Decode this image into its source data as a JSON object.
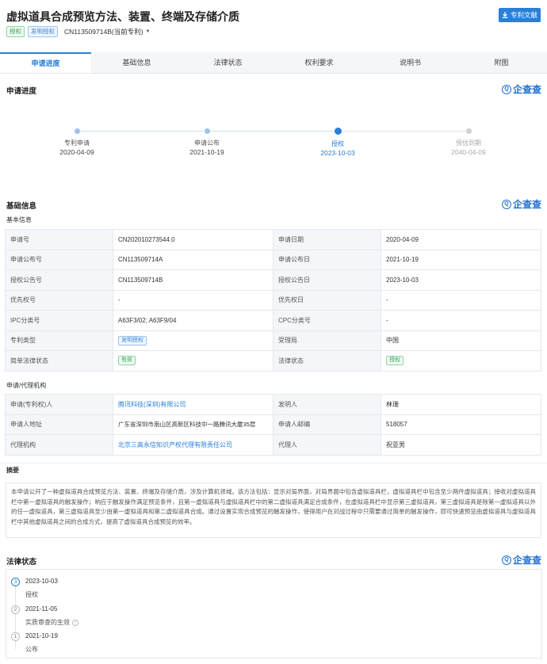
{
  "header": {
    "title": "虚拟道具合成预览方法、装置、终端及存储介质",
    "download_label": "专利文献",
    "tags": [
      "授权",
      "发明授权"
    ],
    "publication_selector": "CN113509714B(当前专利)"
  },
  "tabs": [
    {
      "label": "申请进度",
      "active": true
    },
    {
      "label": "基础信息"
    },
    {
      "label": "法律状态"
    },
    {
      "label": "权利要求"
    },
    {
      "label": "说明书"
    },
    {
      "label": "附图"
    }
  ],
  "brand": "企查查",
  "progress": {
    "title": "申请进度",
    "steps": [
      {
        "label": "专利申请",
        "date": "2020-04-09",
        "state": "done"
      },
      {
        "label": "申请公布",
        "date": "2021-10-19",
        "state": "done"
      },
      {
        "label": "授权",
        "date": "2023-10-03",
        "state": "current"
      },
      {
        "label": "预估到期",
        "date": "2040-04-09",
        "state": "future"
      }
    ]
  },
  "basic": {
    "title": "基础信息",
    "subtitle": "基本信息",
    "rows": [
      [
        "申请号",
        "CN202010273544.0",
        "申请日期",
        "2020-04-09"
      ],
      [
        "申请公布号",
        "CN113509714A",
        "申请公布日",
        "2021-10-19"
      ],
      [
        "授权公告号",
        "CN113509714B",
        "授权公告日",
        "2023-10-03"
      ],
      [
        "优先权号",
        "-",
        "优先权日",
        "-"
      ],
      [
        "IPC分类号",
        "A63F3/02; A63F9/04",
        "CPC分类号",
        "-"
      ],
      [
        "专利类型",
        "发明授权",
        "受理局",
        "中国"
      ],
      [
        "简单法律状态",
        "有效",
        "法律状态",
        "授权"
      ]
    ]
  },
  "agency": {
    "subtitle": "申请/代理机构",
    "rows": [
      [
        "申请(专利权)人",
        "腾讯科技(深圳)有限公司",
        "发明人",
        "林珊"
      ],
      [
        "申请人地址",
        "广东省深圳市南山区高新区科技中一路腾讯大厦35层",
        "申请人邮编",
        "518057"
      ],
      [
        "代理机构",
        "北京三高永信知识产权代理有限责任公司",
        "代理人",
        "祝亚男"
      ]
    ]
  },
  "abstract": {
    "title": "摘要",
    "text": "本申请公开了一种虚拟道具合成预览方法、装置、终端及存储介质，涉及计算机领域。该方法包括：显示对局界面，对局界面中包含虚拟道具栏，虚拟道具栏中包含至少两件虚拟道具；接收对虚拟道具栏中第一虚拟道具的触发操作；响应于触发操作满足预览条件，且第一虚拟道具与虚拟道具栏中的第二虚拟道具满足合成条件，在虚拟道具栏中显示第三虚拟道具，第三虚拟道具是除第一虚拟道具以外的任一虚拟道具，第三虚拟道具至少由第一虚拟道具和第二虚拟道具合成。通过设置实现合成预览的触发操作，使得用户在对战过程中只需要通过简单的触发操作，即可快速预览由虚拟道具与虚拟道具栏中其他虚拟道具之间的合成方式，提高了虚拟道具合成预览的效率。"
  },
  "legal": {
    "title": "法律状态",
    "events": [
      {
        "num": "3",
        "date": "2023-10-03",
        "text": "授权",
        "info": false
      },
      {
        "num": "2",
        "date": "2021-11-05",
        "text": "实质审查的生效",
        "info": true
      },
      {
        "num": "1",
        "date": "2021-10-19",
        "text": "公布",
        "info": false
      }
    ]
  },
  "colors": {
    "accent": "#2a7fd9",
    "tag_green": "#3aa35a",
    "tag_blue": "#3d86d8",
    "status_valid": "#3aa35a"
  }
}
